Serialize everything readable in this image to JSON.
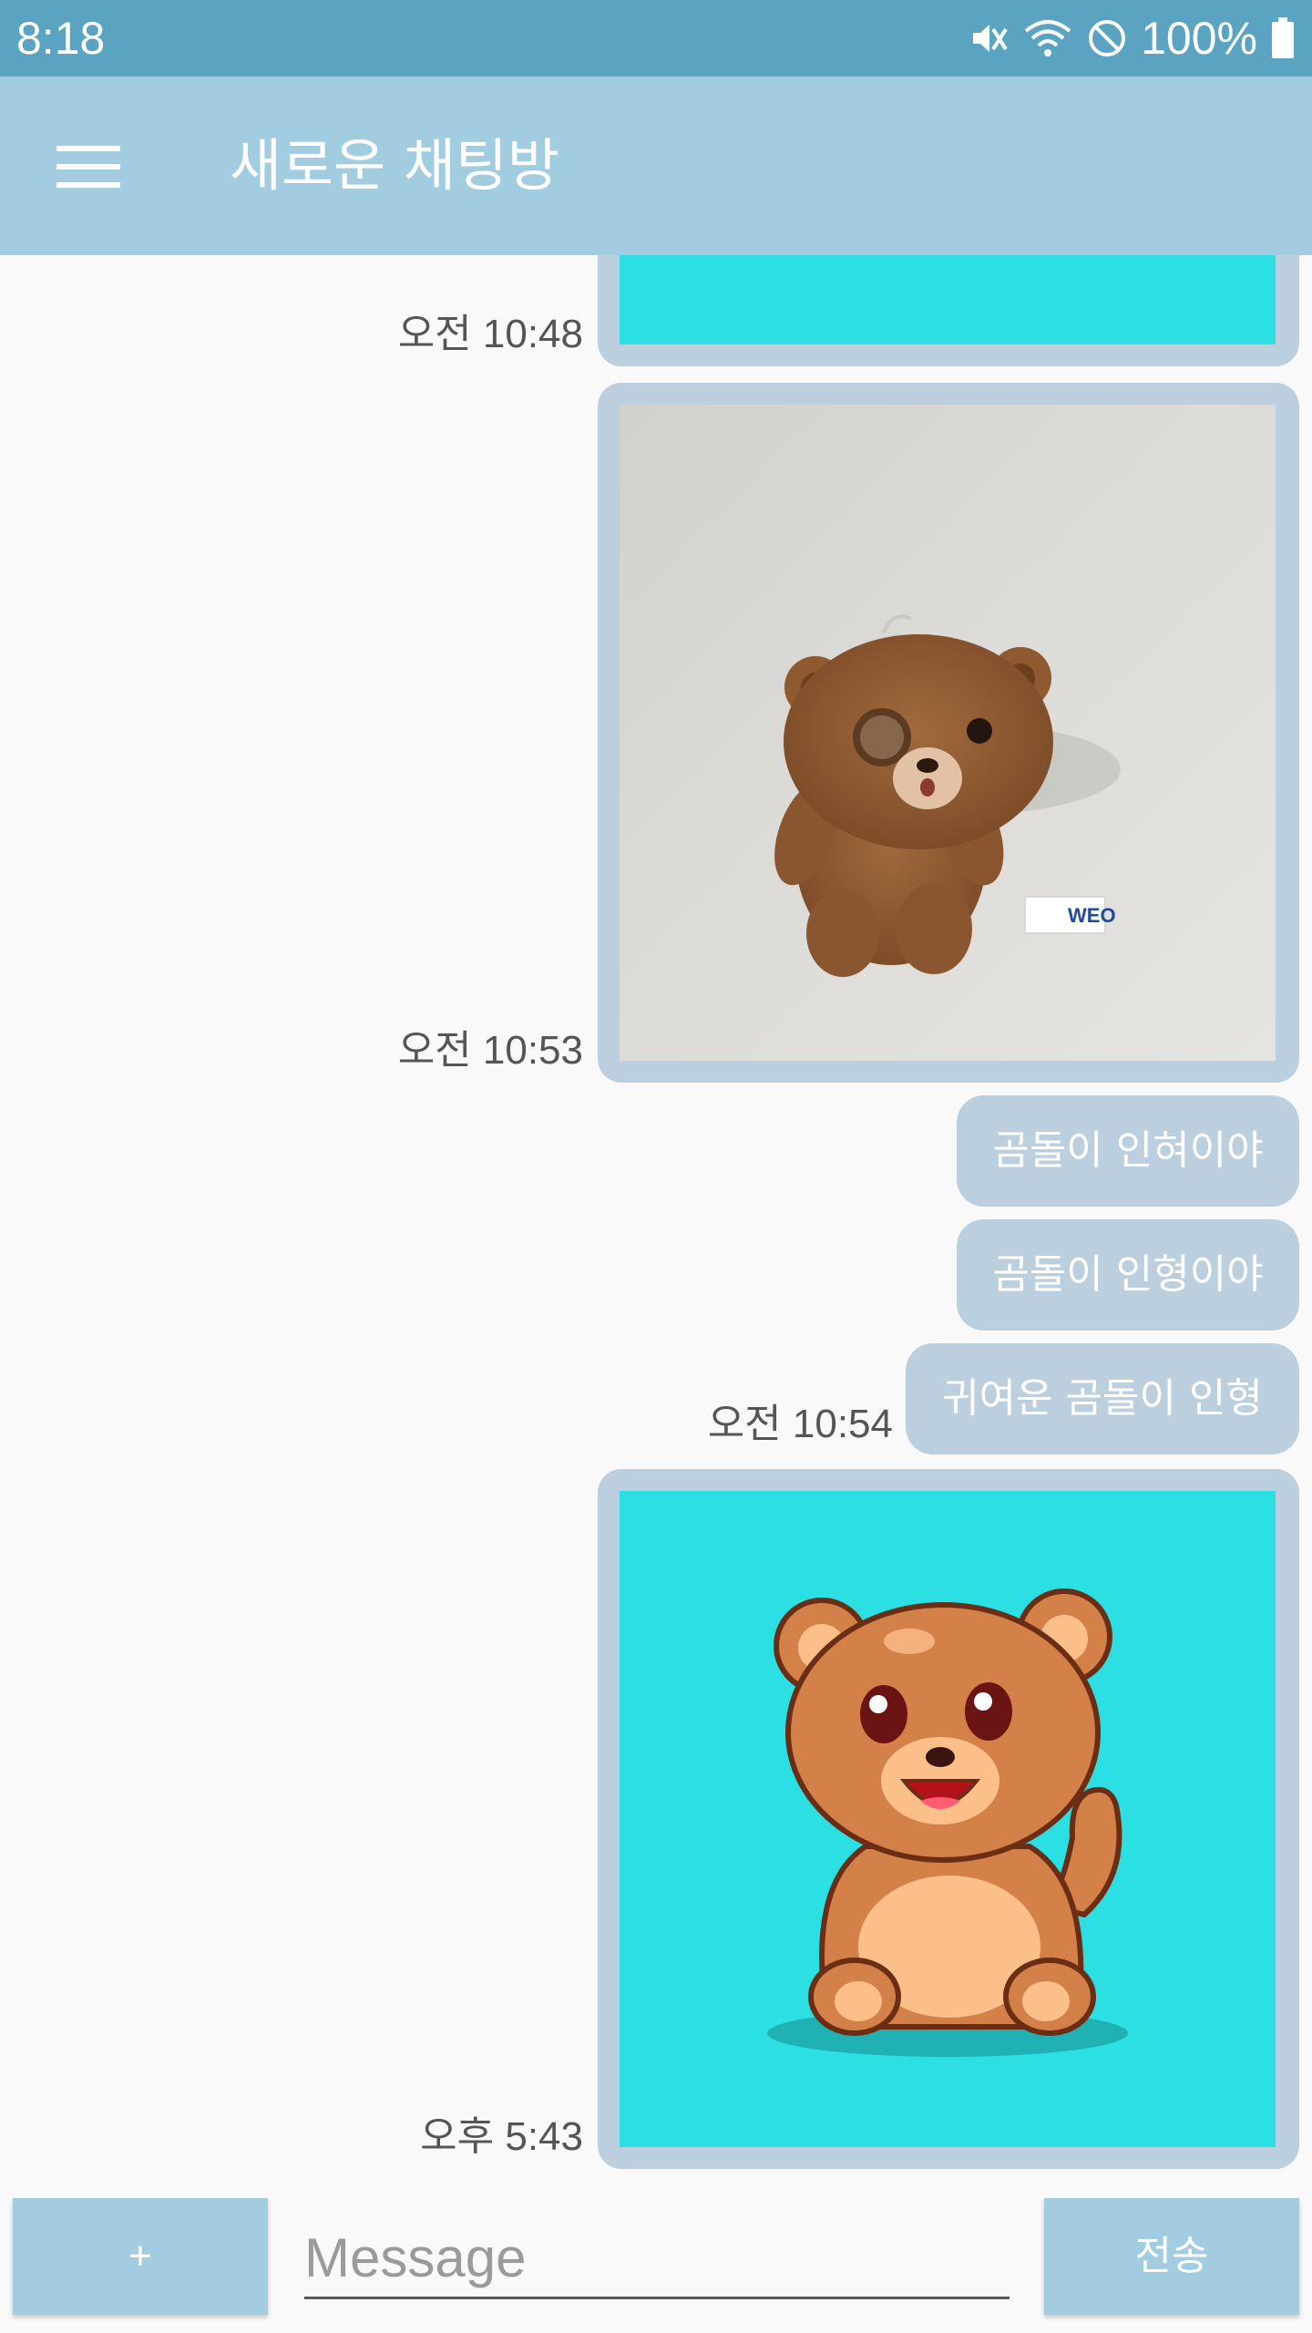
{
  "status_bar": {
    "time": "8:18",
    "battery": "100%",
    "icons": [
      "mute-icon",
      "wifi-icon",
      "blocked-icon",
      "battery-icon"
    ]
  },
  "app_bar": {
    "title": "새로운 채팅방",
    "menu_icon": "hamburger-menu-icon"
  },
  "messages": [
    {
      "type": "image",
      "image": "teal-background-image",
      "time": "오전 10:48"
    },
    {
      "type": "image",
      "image": "teddy-bear-photo",
      "badge": "WEO",
      "time": "오전 10:53"
    },
    {
      "type": "text",
      "text": "곰돌이 인혀이야"
    },
    {
      "type": "text",
      "text": "곰돌이 인형이야"
    },
    {
      "type": "text",
      "text": "귀여운 곰돌이 인형",
      "time": "오전 10:54"
    },
    {
      "type": "image",
      "image": "cartoon-bear-illustration",
      "time": "오후 5:43"
    }
  ],
  "composer": {
    "plus_label": "+",
    "placeholder": "Message",
    "value": "",
    "send_label": "전송"
  },
  "colors": {
    "status_bar": "#5aa4c1",
    "app_bar": "#a2cde0",
    "bubble": "#bccfdf",
    "teal": "#2bdfe2",
    "background": "#f9f9fa"
  }
}
